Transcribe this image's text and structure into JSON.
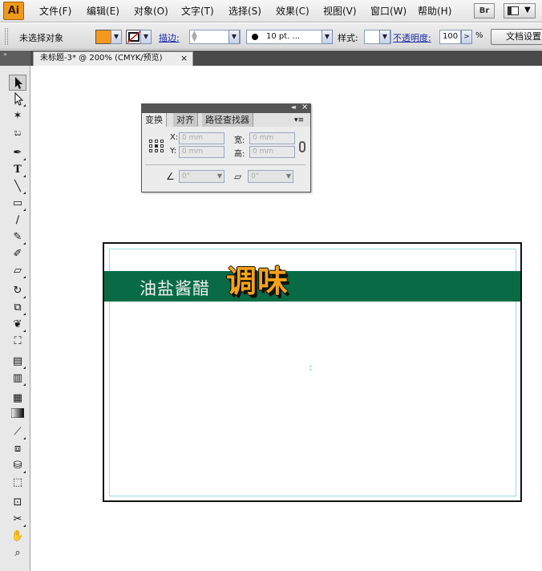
{
  "app": {
    "logo": "Ai"
  },
  "menu": {
    "items": [
      "文件(F)",
      "编辑(E)",
      "对象(O)",
      "文字(T)",
      "选择(S)",
      "效果(C)",
      "视图(V)",
      "窗口(W)",
      "帮助(H)"
    ],
    "bridge_label": "Br"
  },
  "control_bar": {
    "selection_status": "未选择对象",
    "fill_color": "#f39a1e",
    "stroke_label": "描边:",
    "brush_size": "10 pt. ...",
    "style_label": "样式:",
    "opacity_label": "不透明度:",
    "opacity_value": "100",
    "opacity_unit": "%",
    "doc_setup_label": "文档设置"
  },
  "tabs": {
    "toolbox_collapse": "»",
    "document_tab": "未标题-3* @ 200% (CMYK/预览)",
    "close_symbol": "×"
  },
  "transform_panel": {
    "tabs": [
      "变换",
      "对齐",
      "路径查找器"
    ],
    "active_tab": "变换",
    "x_label": "X:",
    "y_label": "Y:",
    "w_label": "宽:",
    "h_label": "高:",
    "x_value": "0 mm",
    "y_value": "0 mm",
    "w_value": "0 mm",
    "h_value": "0 mm",
    "rotate_value": "0°",
    "shear_value": "0°",
    "collapse_symbol": "◂◂",
    "close_symbol": "×",
    "menu_symbol": "▾≡"
  },
  "artwork": {
    "band_text": "油盐酱醋",
    "brand_text": "调味",
    "band_color": "#086b45",
    "brand_color": "#f5a21a"
  },
  "tools": [
    "selection-tool-icon",
    "direct-selection-tool-icon",
    "magic-wand-tool-icon",
    "lasso-tool-icon",
    "pen-tool-icon",
    "type-tool-icon",
    "line-tool-icon",
    "rectangle-tool-icon",
    "paintbrush-tool-icon",
    "pencil-tool-icon",
    "blob-brush-tool-icon",
    "eraser-tool-icon",
    "rotate-tool-icon",
    "scale-tool-icon",
    "warp-tool-icon",
    "free-transform-tool-icon",
    "symbol-sprayer-tool-icon",
    "column-graph-tool-icon",
    "mesh-tool-icon",
    "gradient-tool-icon",
    "eyedropper-tool-icon",
    "blend-tool-icon",
    "live-paint-bucket-tool-icon",
    "live-paint-selection-tool-icon",
    "artboard-tool-icon",
    "slice-tool-icon",
    "hand-tool-icon",
    "zoom-tool-icon"
  ]
}
